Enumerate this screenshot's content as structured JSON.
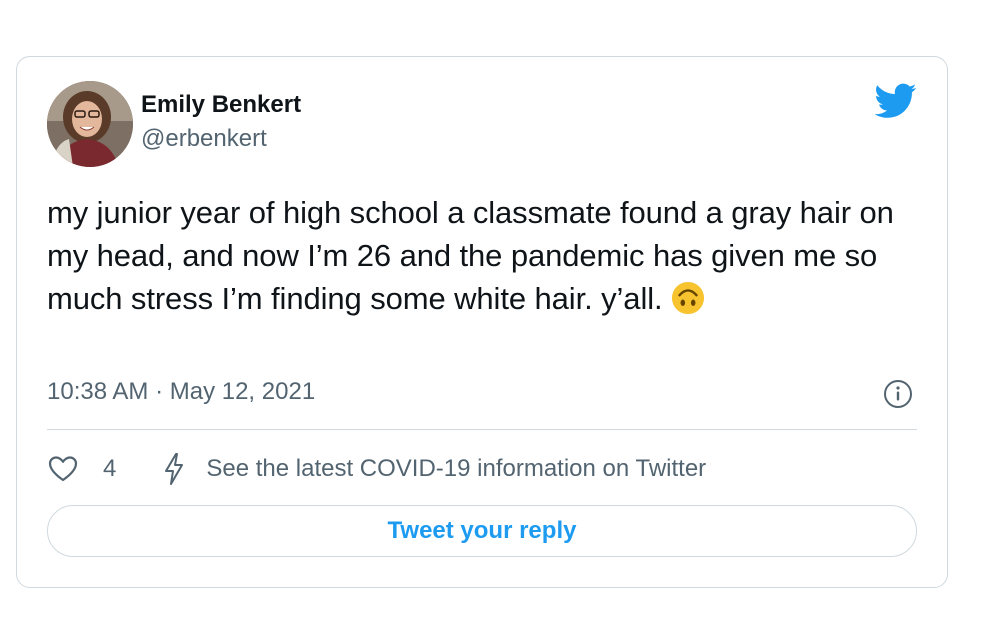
{
  "author": {
    "name": "Emily Benkert",
    "handle": "@erbenkert"
  },
  "tweet": {
    "text": "my junior year of high school a classmate found a gray hair on my head, and now I’m 26 and the pandemic has given me so much stress I’m finding some white hair. y’all.",
    "emoji": "upside-down-face",
    "timestamp": "10:38 AM · May 12, 2021"
  },
  "actions": {
    "like_count": "4",
    "covid_info": "See the latest COVID-19 information on Twitter"
  },
  "reply": {
    "label": "Tweet your reply"
  },
  "colors": {
    "accent": "#1d9bf0",
    "secondary_text": "#536471",
    "border": "#cfd9de",
    "emoji": "#f7c32e"
  },
  "icons": [
    "twitter-bird-icon",
    "info-icon",
    "heart-icon",
    "lightning-bolt-icon",
    "upside-down-face-emoji"
  ]
}
